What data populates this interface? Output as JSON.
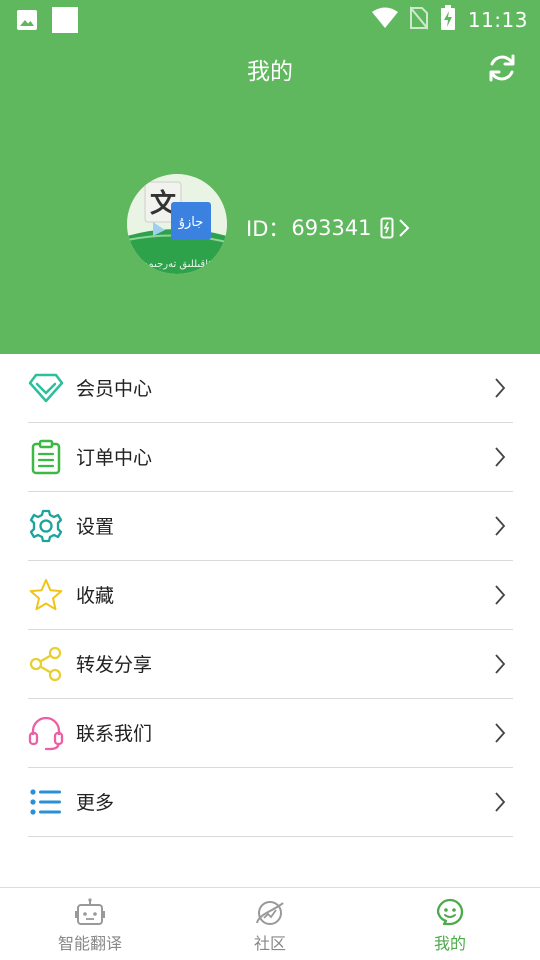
{
  "status_bar": {
    "time": "11:13"
  },
  "header": {
    "title": "我的",
    "id_label": "ID：",
    "user_id": "693341",
    "avatar_text_top": "文",
    "avatar_text_side": "جازۇ",
    "avatar_text_band": "ئاقىللىق تەرجىمە"
  },
  "menu": {
    "items": [
      {
        "label": "会员中心",
        "icon": "diamond-icon",
        "color": "#2bbf9c"
      },
      {
        "label": "订单中心",
        "icon": "clipboard-icon",
        "color": "#3db843"
      },
      {
        "label": "设置",
        "icon": "gear-icon",
        "color": "#1ca39c"
      },
      {
        "label": "收藏",
        "icon": "star-icon",
        "color": "#f0c419"
      },
      {
        "label": "转发分享",
        "icon": "share-icon",
        "color": "#e8cf2c"
      },
      {
        "label": "联系我们",
        "icon": "headset-icon",
        "color": "#ec5fa2"
      },
      {
        "label": "更多",
        "icon": "list-icon",
        "color": "#2b8fd6"
      }
    ]
  },
  "bottom_nav": {
    "items": [
      {
        "label": "智能翻译",
        "icon": "robot-icon",
        "active": false
      },
      {
        "label": "社区",
        "icon": "planet-icon",
        "active": false
      },
      {
        "label": "我的",
        "icon": "smile-face-icon",
        "active": true
      }
    ]
  },
  "colors": {
    "primary_green": "#5fb85d",
    "active_green": "#4caa4a",
    "inactive_gray": "#888888"
  }
}
